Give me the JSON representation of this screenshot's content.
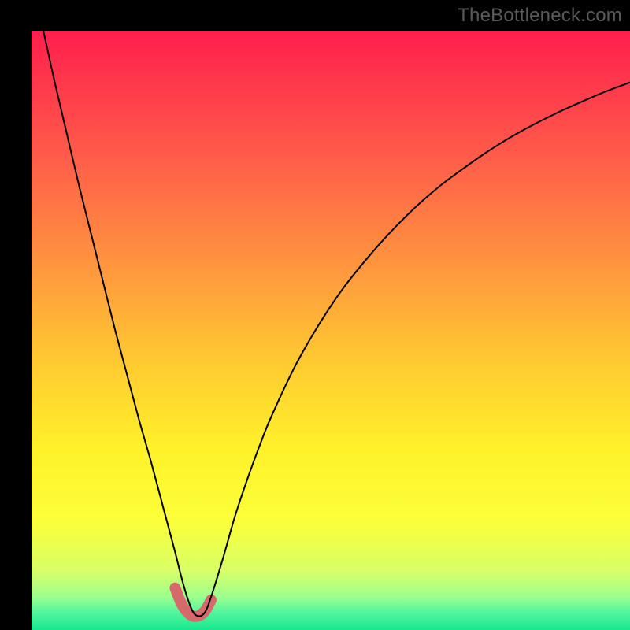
{
  "watermark": "TheBottleneck.com",
  "chart_data": {
    "type": "line",
    "title": "",
    "xlabel": "",
    "ylabel": "",
    "xlim": [
      0,
      100
    ],
    "ylim": [
      0,
      100
    ],
    "axes_visible": false,
    "background": {
      "type": "vertical-gradient",
      "stops": [
        {
          "pos": 0.0,
          "color": "#ff1f4d"
        },
        {
          "pos": 0.2,
          "color": "#ff594a"
        },
        {
          "pos": 0.4,
          "color": "#ff983e"
        },
        {
          "pos": 0.55,
          "color": "#ffc931"
        },
        {
          "pos": 0.7,
          "color": "#fff22a"
        },
        {
          "pos": 0.82,
          "color": "#fbff3a"
        },
        {
          "pos": 0.9,
          "color": "#d8ff66"
        },
        {
          "pos": 0.945,
          "color": "#9cff8e"
        },
        {
          "pos": 0.97,
          "color": "#54f59e"
        },
        {
          "pos": 1.0,
          "color": "#17e88f"
        }
      ]
    },
    "series": [
      {
        "name": "bottleneck-curve",
        "color": "#000000",
        "width": 2,
        "x": [
          2,
          4,
          6,
          8,
          10,
          12,
          14,
          16,
          18,
          20,
          22,
          24,
          25,
          26,
          27,
          28,
          29,
          30,
          32,
          34,
          36,
          38,
          40,
          44,
          48,
          52,
          56,
          60,
          64,
          68,
          72,
          76,
          80,
          84,
          88,
          92,
          96,
          100
        ],
        "values": [
          100,
          91,
          82.5,
          74,
          66,
          58,
          50,
          42.5,
          35,
          28,
          20.5,
          13,
          9,
          5.5,
          3,
          2.3,
          3,
          5.5,
          12,
          19,
          25,
          30.5,
          35.5,
          44,
          51,
          57,
          62,
          66.5,
          70.5,
          74,
          77,
          79.8,
          82.3,
          84.5,
          86.5,
          88.3,
          90,
          91.5
        ]
      },
      {
        "name": "valley-highlight",
        "color": "#d66a6a",
        "width": 14,
        "linecap": "round",
        "x": [
          24,
          25,
          26,
          27,
          28,
          29,
          30
        ],
        "values": [
          7,
          4.5,
          3,
          2.3,
          2.4,
          3.2,
          5
        ]
      }
    ],
    "valley_x": 27
  }
}
